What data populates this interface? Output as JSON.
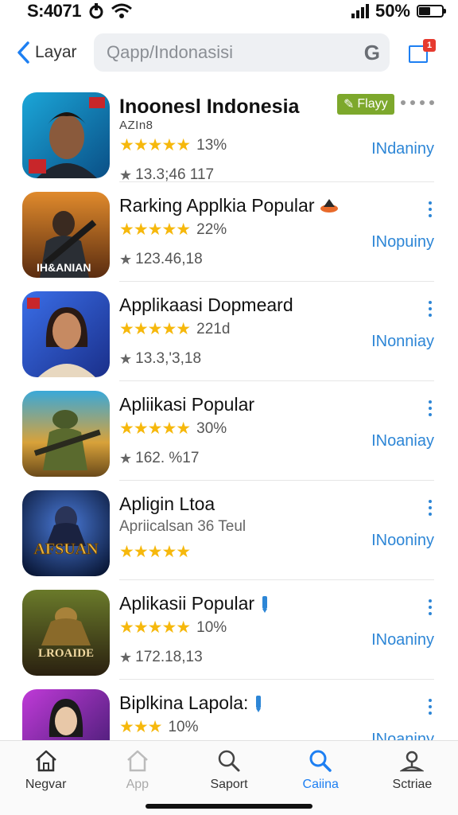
{
  "status": {
    "time": "S:4071",
    "battery": "50%",
    "battery_level": 0.5
  },
  "topbar": {
    "back_label": "Layar",
    "search_text": "Qapp/Indonasisi",
    "search_icon_letter": "G",
    "notif_count": "1"
  },
  "apps": [
    {
      "title": "Inoonesl Indonesia",
      "subtitle": "AZIn8",
      "rating_stars": "★★★★★",
      "rating_pct": "13%",
      "meta": "13.3;46 117",
      "action": "INdaniny",
      "flag": "Flayy"
    },
    {
      "title": "Rarking Applkia Popular",
      "rating_stars": "★★★★★",
      "rating_pct": "22%",
      "meta": "123.46,18",
      "action": "INopuiny"
    },
    {
      "title": "Applikaasi Dopmeard",
      "rating_stars": "★★★★★",
      "rating_pct": "221d",
      "meta": "13.3,'3,18",
      "action": "INonniay"
    },
    {
      "title": "Apliikasi Popular",
      "rating_stars": "★★★★★",
      "rating_pct": "30%",
      "meta": "162. %17",
      "action": "INoaniay"
    },
    {
      "title": "Apligin Ltoa",
      "subtitle": "Apriicalsan 36 Teul",
      "rating_stars": "★★★★★",
      "action": "INooniny",
      "thumb_text": "AFSUAN"
    },
    {
      "title": "Aplikasii Popular",
      "rating_stars": "★★★★★",
      "rating_pct": "10%",
      "meta": "172.18,13",
      "action": "INoaniny",
      "thumb_text": "LROAIDE"
    },
    {
      "title": "Biplkina Lapola:",
      "rating_stars": "★★★",
      "rating_pct": "10%",
      "action": "INoaniny"
    }
  ],
  "nav": [
    {
      "label": "Negvar",
      "icon": "home-icon"
    },
    {
      "label": "App",
      "icon": "home-outline-icon"
    },
    {
      "label": "Saport",
      "icon": "search-icon"
    },
    {
      "label": "Caiina",
      "icon": "search-icon"
    },
    {
      "label": "Sctriae",
      "icon": "person-icon"
    }
  ],
  "colors": {
    "accent": "#1d7ff2",
    "star": "#f6b80c",
    "flag": "#7da82c",
    "badge": "#e63a2f"
  }
}
